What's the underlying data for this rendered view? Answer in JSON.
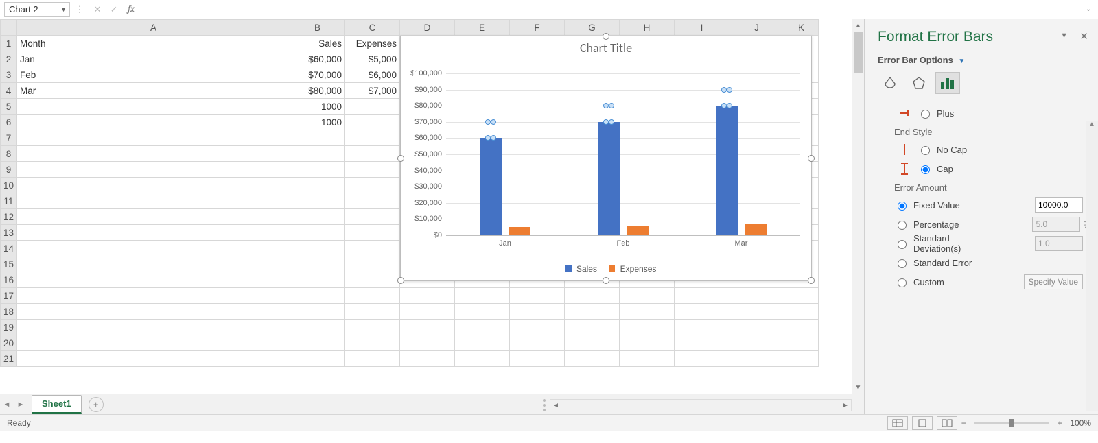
{
  "formula_bar": {
    "name_box": "Chart 2",
    "fx_label": "fx"
  },
  "columns": [
    "A",
    "B",
    "C",
    "D",
    "E",
    "F",
    "G",
    "H",
    "I",
    "J",
    "K"
  ],
  "row_headers_count": 21,
  "cells": {
    "A1": "Month",
    "B1": "Sales",
    "C1": "Expenses",
    "A2": "Jan",
    "B2": "$60,000",
    "C2": "$5,000",
    "A3": "Feb",
    "B3": "$70,000",
    "C3": "$6,000",
    "A4": "Mar",
    "B4": "$80,000",
    "C4": "$7,000",
    "B5": "1000",
    "B6": "1000"
  },
  "sheet_tabs": {
    "active": "Sheet1"
  },
  "chart_data": {
    "type": "bar",
    "title": "Chart Title",
    "categories": [
      "Jan",
      "Feb",
      "Mar"
    ],
    "series": [
      {
        "name": "Sales",
        "color": "#4472c4",
        "values": [
          60000,
          70000,
          80000
        ],
        "error_bars": {
          "direction": "Plus",
          "end_style": "Cap",
          "amount_type": "Fixed Value",
          "amount": 10000
        }
      },
      {
        "name": "Expenses",
        "color": "#ed7d31",
        "values": [
          5000,
          6000,
          7000
        ]
      }
    ],
    "ylim": [
      0,
      100000
    ],
    "y_ticks": [
      "$0",
      "$10,000",
      "$20,000",
      "$30,000",
      "$40,000",
      "$50,000",
      "$60,000",
      "$70,000",
      "$80,000",
      "$90,000",
      "$100,000"
    ],
    "legend": [
      "Sales",
      "Expenses"
    ]
  },
  "panel": {
    "title": "Format Error Bars",
    "subtitle": "Error Bar Options",
    "direction": {
      "options": [
        "Plus"
      ],
      "selected": "Plus"
    },
    "end_style": {
      "label": "End Style",
      "options": [
        "No Cap",
        "Cap"
      ],
      "selected": "Cap"
    },
    "error_amount": {
      "label": "Error Amount",
      "options": [
        {
          "name": "Fixed Value",
          "value": "10000.0",
          "selected": true
        },
        {
          "name": "Percentage",
          "value": "5.0",
          "suffix": "%",
          "selected": false
        },
        {
          "name": "Standard Deviation(s)",
          "value": "1.0",
          "selected": false
        },
        {
          "name": "Standard Error",
          "selected": false
        },
        {
          "name": "Custom",
          "button": "Specify Value",
          "selected": false
        }
      ]
    }
  },
  "status_bar": {
    "ready": "Ready",
    "zoom": "100%"
  }
}
